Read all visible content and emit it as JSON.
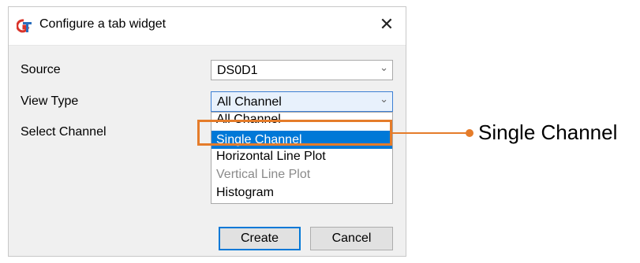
{
  "dialog": {
    "title": "Configure a tab widget",
    "app_icon": "gt-app-icon",
    "close_glyph": "✕"
  },
  "form": {
    "source_label": "Source",
    "source_value": "DS0D1",
    "view_type_label": "View Type",
    "view_type_value": "All Channel",
    "select_channel_label": "Select Channel",
    "view_type_options": [
      {
        "label": "All Channel",
        "state": "normal"
      },
      {
        "label": "Single Channel",
        "state": "selected"
      },
      {
        "label": "Horizontal Line Plot",
        "state": "normal"
      },
      {
        "label": "Vertical Line Plot",
        "state": "disabled"
      },
      {
        "label": "Histogram",
        "state": "normal"
      }
    ]
  },
  "buttons": {
    "create": "Create",
    "cancel": "Cancel"
  },
  "callout": {
    "text": "Single Channel",
    "color": "#e57c2a"
  },
  "colors": {
    "selection": "#0078d7",
    "dialog_bg": "#f0f0f0"
  }
}
